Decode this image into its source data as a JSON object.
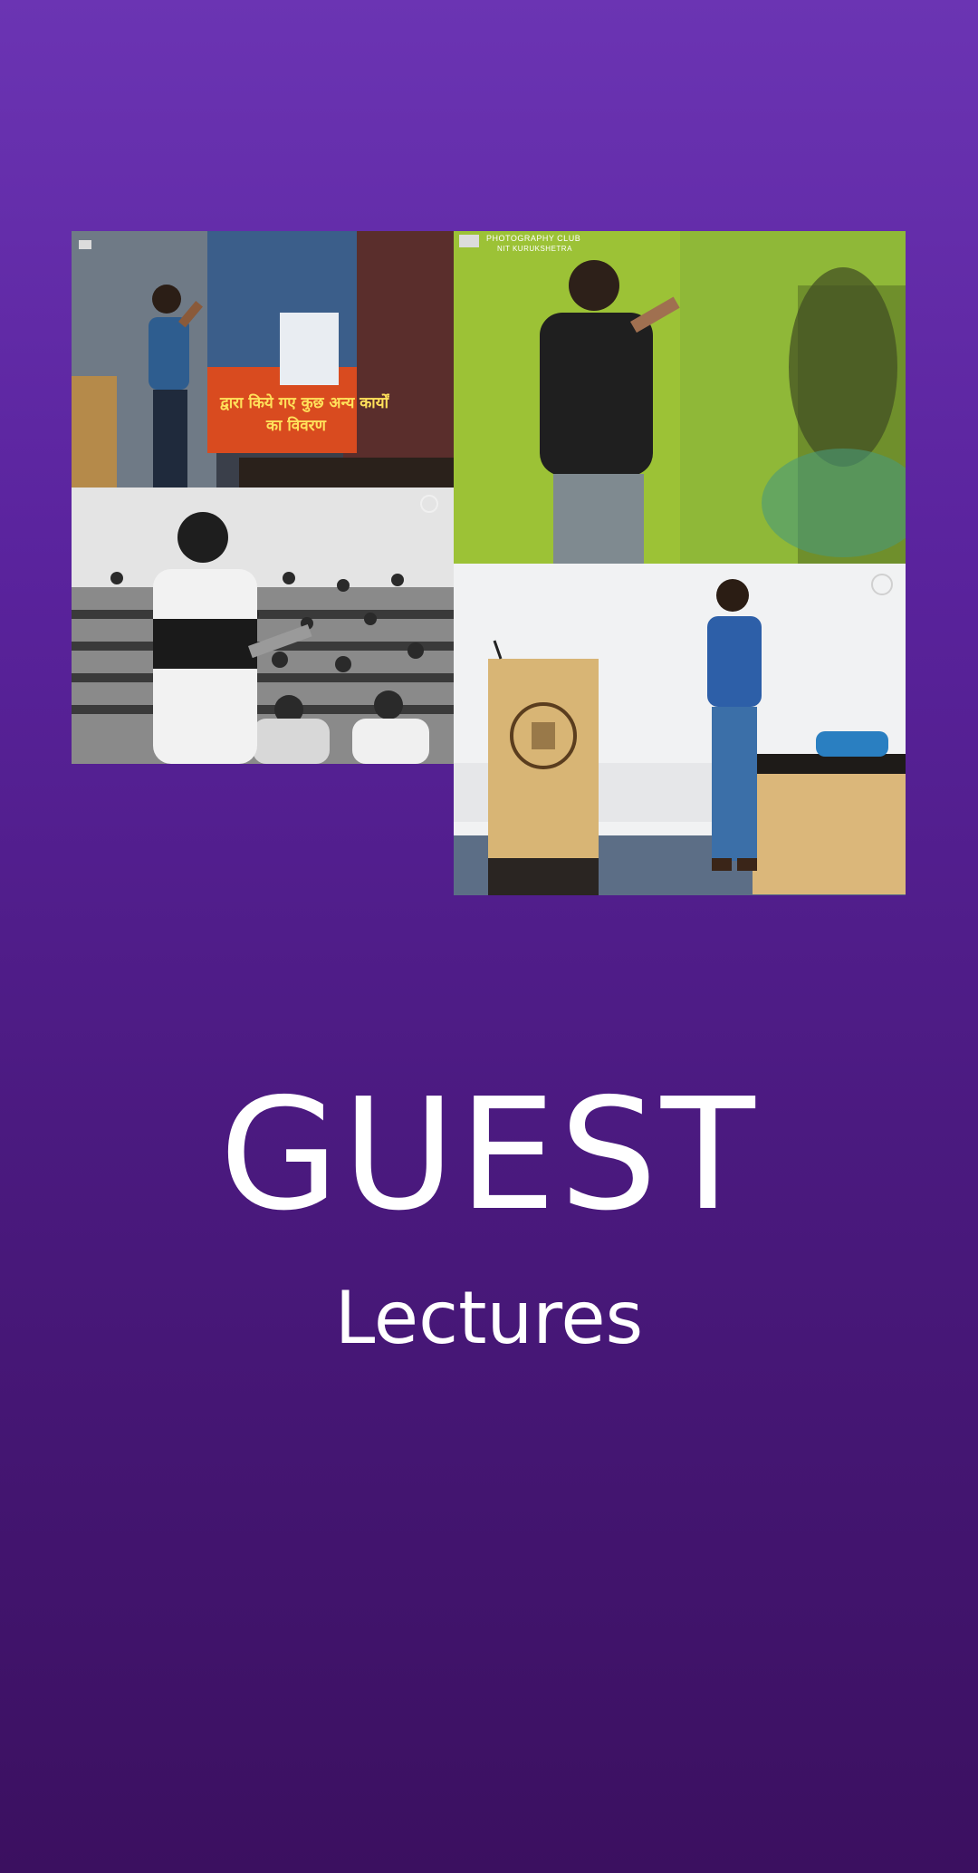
{
  "title": "GUEST",
  "subtitle": "Lectures",
  "photos": {
    "watermark_line1": "PHOTOGRAPHY CLUB",
    "watermark_line2": "NIT KURUKSHETRA",
    "banner_line1": "द्वारा किये गए कुछ अन्य कार्यों",
    "banner_line2": "का विवरण"
  },
  "colors": {
    "background_top": "#6b34b3",
    "background_bottom": "#3b1060",
    "text": "#ffffff"
  }
}
